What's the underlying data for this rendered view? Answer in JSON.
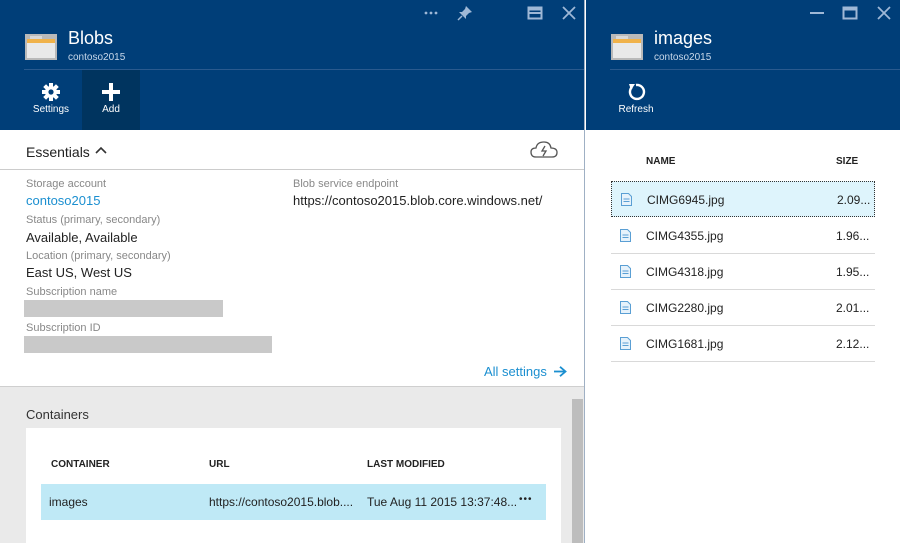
{
  "left_blade": {
    "title": "Blobs",
    "subtitle": "contoso2015",
    "commands": {
      "settings": "Settings",
      "add": "Add"
    },
    "essentials": {
      "title": "Essentials",
      "storage_account_label": "Storage account",
      "storage_account_value": "contoso2015",
      "status_label": "Status (primary, secondary)",
      "status_value": "Available, Available",
      "location_label": "Location (primary, secondary)",
      "location_value": "East US, West US",
      "subscription_name_label": "Subscription name",
      "subscription_id_label": "Subscription ID",
      "endpoint_label": "Blob service endpoint",
      "endpoint_value": "https://contoso2015.blob.core.windows.net/",
      "all_settings": "All settings"
    },
    "containers": {
      "title": "Containers",
      "columns": [
        "CONTAINER",
        "URL",
        "LAST MODIFIED"
      ],
      "rows": [
        {
          "name": "images",
          "url": "https://contoso2015.blob....",
          "modified": "Tue Aug 11 2015 13:37:48...",
          "more": "•••"
        }
      ]
    }
  },
  "right_blade": {
    "title": "images",
    "subtitle": "contoso2015",
    "commands": {
      "refresh": "Refresh"
    },
    "columns": [
      "NAME",
      "SIZE"
    ],
    "files": [
      {
        "name": "CIMG6945.jpg",
        "size": "2.09..."
      },
      {
        "name": "CIMG4355.jpg",
        "size": "1.96..."
      },
      {
        "name": "CIMG4318.jpg",
        "size": "1.95..."
      },
      {
        "name": "CIMG2280.jpg",
        "size": "2.01..."
      },
      {
        "name": "CIMG1681.jpg",
        "size": "2.12..."
      }
    ]
  },
  "colors": {
    "header_bg": "#003e78",
    "accent_link": "#1b8fd0",
    "selected_row": "#bfe9f6"
  }
}
